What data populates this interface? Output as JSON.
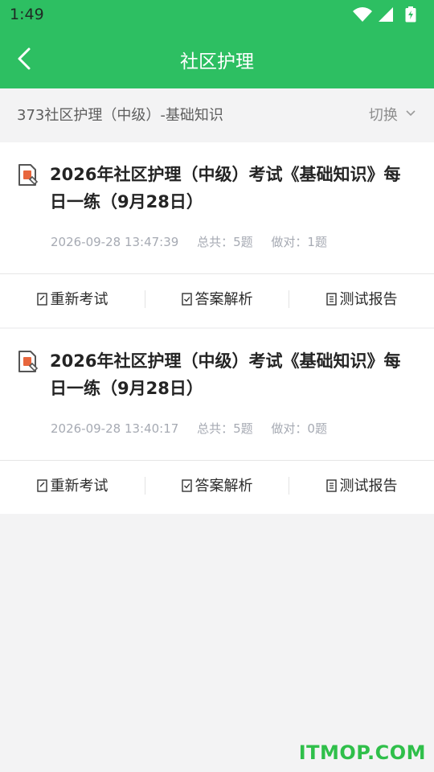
{
  "status_bar": {
    "time": "1:49",
    "icons": [
      "wifi-icon",
      "signal-icon",
      "battery-icon"
    ]
  },
  "header": {
    "title": "社区护理",
    "back_icon": "chevron-left-icon"
  },
  "subject": {
    "text": "373社区护理（中级）-基础知识",
    "switch_label": "切换"
  },
  "records": [
    {
      "title": "2026年社区护理（中级）考试《基础知识》每日一练（9月28日）",
      "datetime": "2026-09-28 13:47:39",
      "total": "总共：5题",
      "done": "做对：1题",
      "actions": [
        "重新考试",
        "答案解析",
        "测试报告"
      ]
    },
    {
      "title": "2026年社区护理（中级）考试《基础知识》每日一练（9月28日）",
      "datetime": "2026-09-28 13:40:17",
      "total": "总共：5题",
      "done": "做对：0题",
      "actions": [
        "重新考试",
        "答案解析",
        "测试报告"
      ]
    }
  ],
  "watermark": "ITMOP.COM",
  "colors": {
    "accent": "#2dbf62",
    "icon_badge": "#e8663d",
    "meta_text": "#a6aab3"
  }
}
